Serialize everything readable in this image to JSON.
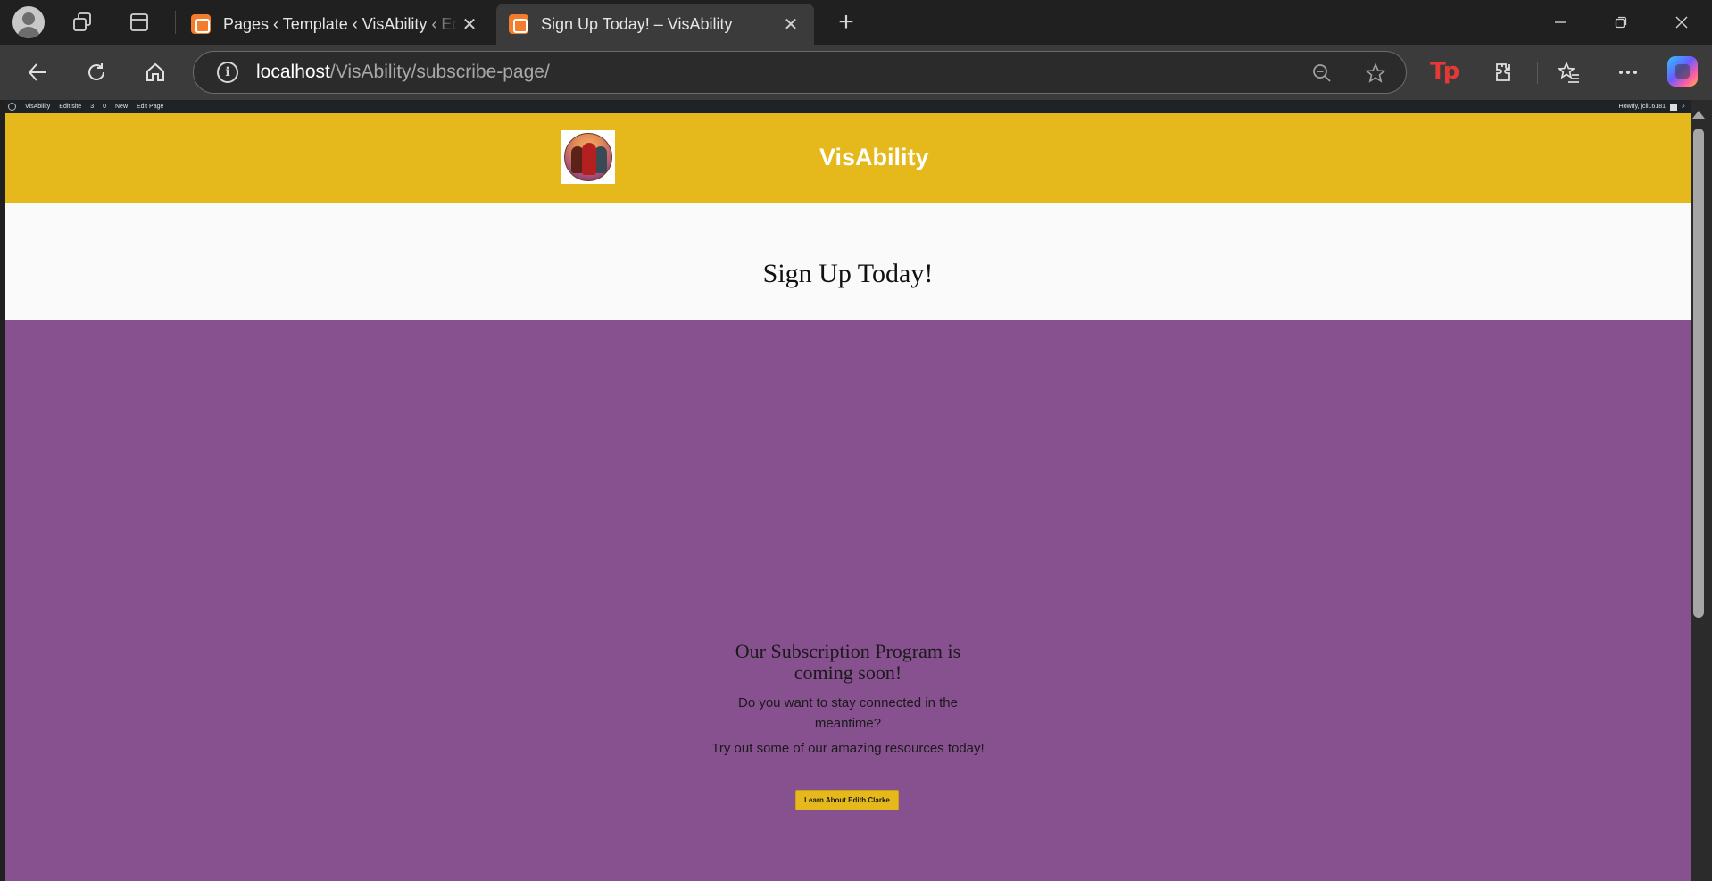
{
  "browser": {
    "tabs": [
      {
        "title": "Pages ‹ Template ‹ VisAbility ‹ Edit",
        "active": false
      },
      {
        "title": "Sign Up Today! – VisAbility",
        "active": true
      }
    ],
    "address": {
      "host": "localhost",
      "path": "/VisAbility/subscribe-page/"
    }
  },
  "admin_bar": {
    "site": "VisAbility",
    "edit_site": "Edit site",
    "updates": "3",
    "comments": "0",
    "new": "New",
    "edit_page": "Edit Page",
    "howdy": "Howdy, jcll16181"
  },
  "site": {
    "title": "VisAbility",
    "page_title": "Sign Up Today!",
    "heading": "Our Subscription Program is coming soon!",
    "paragraph1": "Do you want to stay connected in the meantime?",
    "paragraph2": "Try out some of our amazing resources today!",
    "cta_label": "Learn About Edith Clarke"
  },
  "colors": {
    "header": "#e5b81c",
    "section": "#87518f",
    "title_band": "#fafafa"
  }
}
